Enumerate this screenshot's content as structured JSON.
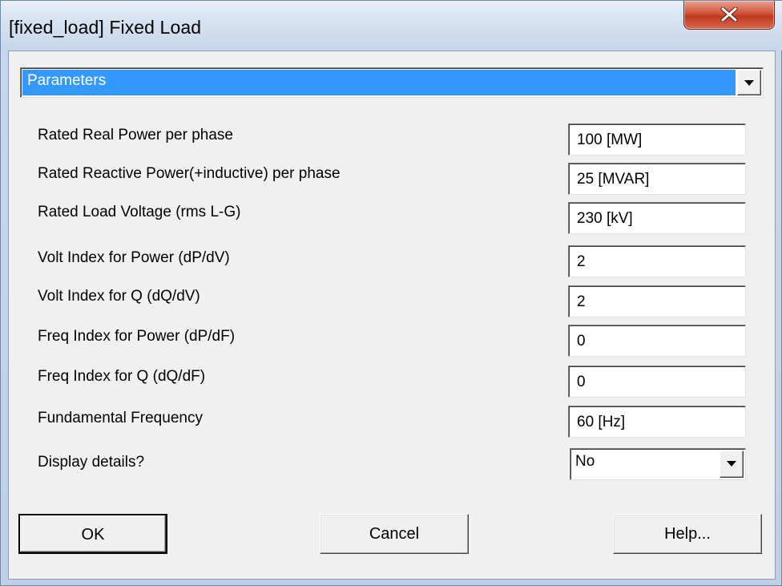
{
  "window": {
    "title": "[fixed_load] Fixed Load"
  },
  "section_selector": {
    "value": "Parameters"
  },
  "parameters": [
    {
      "label": "Rated Real Power per phase",
      "value": "100 [MW]"
    },
    {
      "label": "Rated Reactive Power(+inductive) per phase",
      "value": "25 [MVAR]"
    },
    {
      "label": "Rated Load Voltage (rms L-G)",
      "value": "230 [kV]"
    },
    {
      "label": "Volt Index for Power (dP/dV)",
      "value": "2"
    },
    {
      "label": "Volt Index for Q (dQ/dV)",
      "value": "2"
    },
    {
      "label": "Freq Index for Power (dP/dF)",
      "value": "0"
    },
    {
      "label": "Freq Index for Q (dQ/dF)",
      "value": "0"
    },
    {
      "label": "Fundamental Frequency",
      "value": "60 [Hz]"
    }
  ],
  "display_details": {
    "label": "Display details?",
    "value": "No"
  },
  "buttons": {
    "ok": "OK",
    "cancel": "Cancel",
    "help": "Help..."
  }
}
